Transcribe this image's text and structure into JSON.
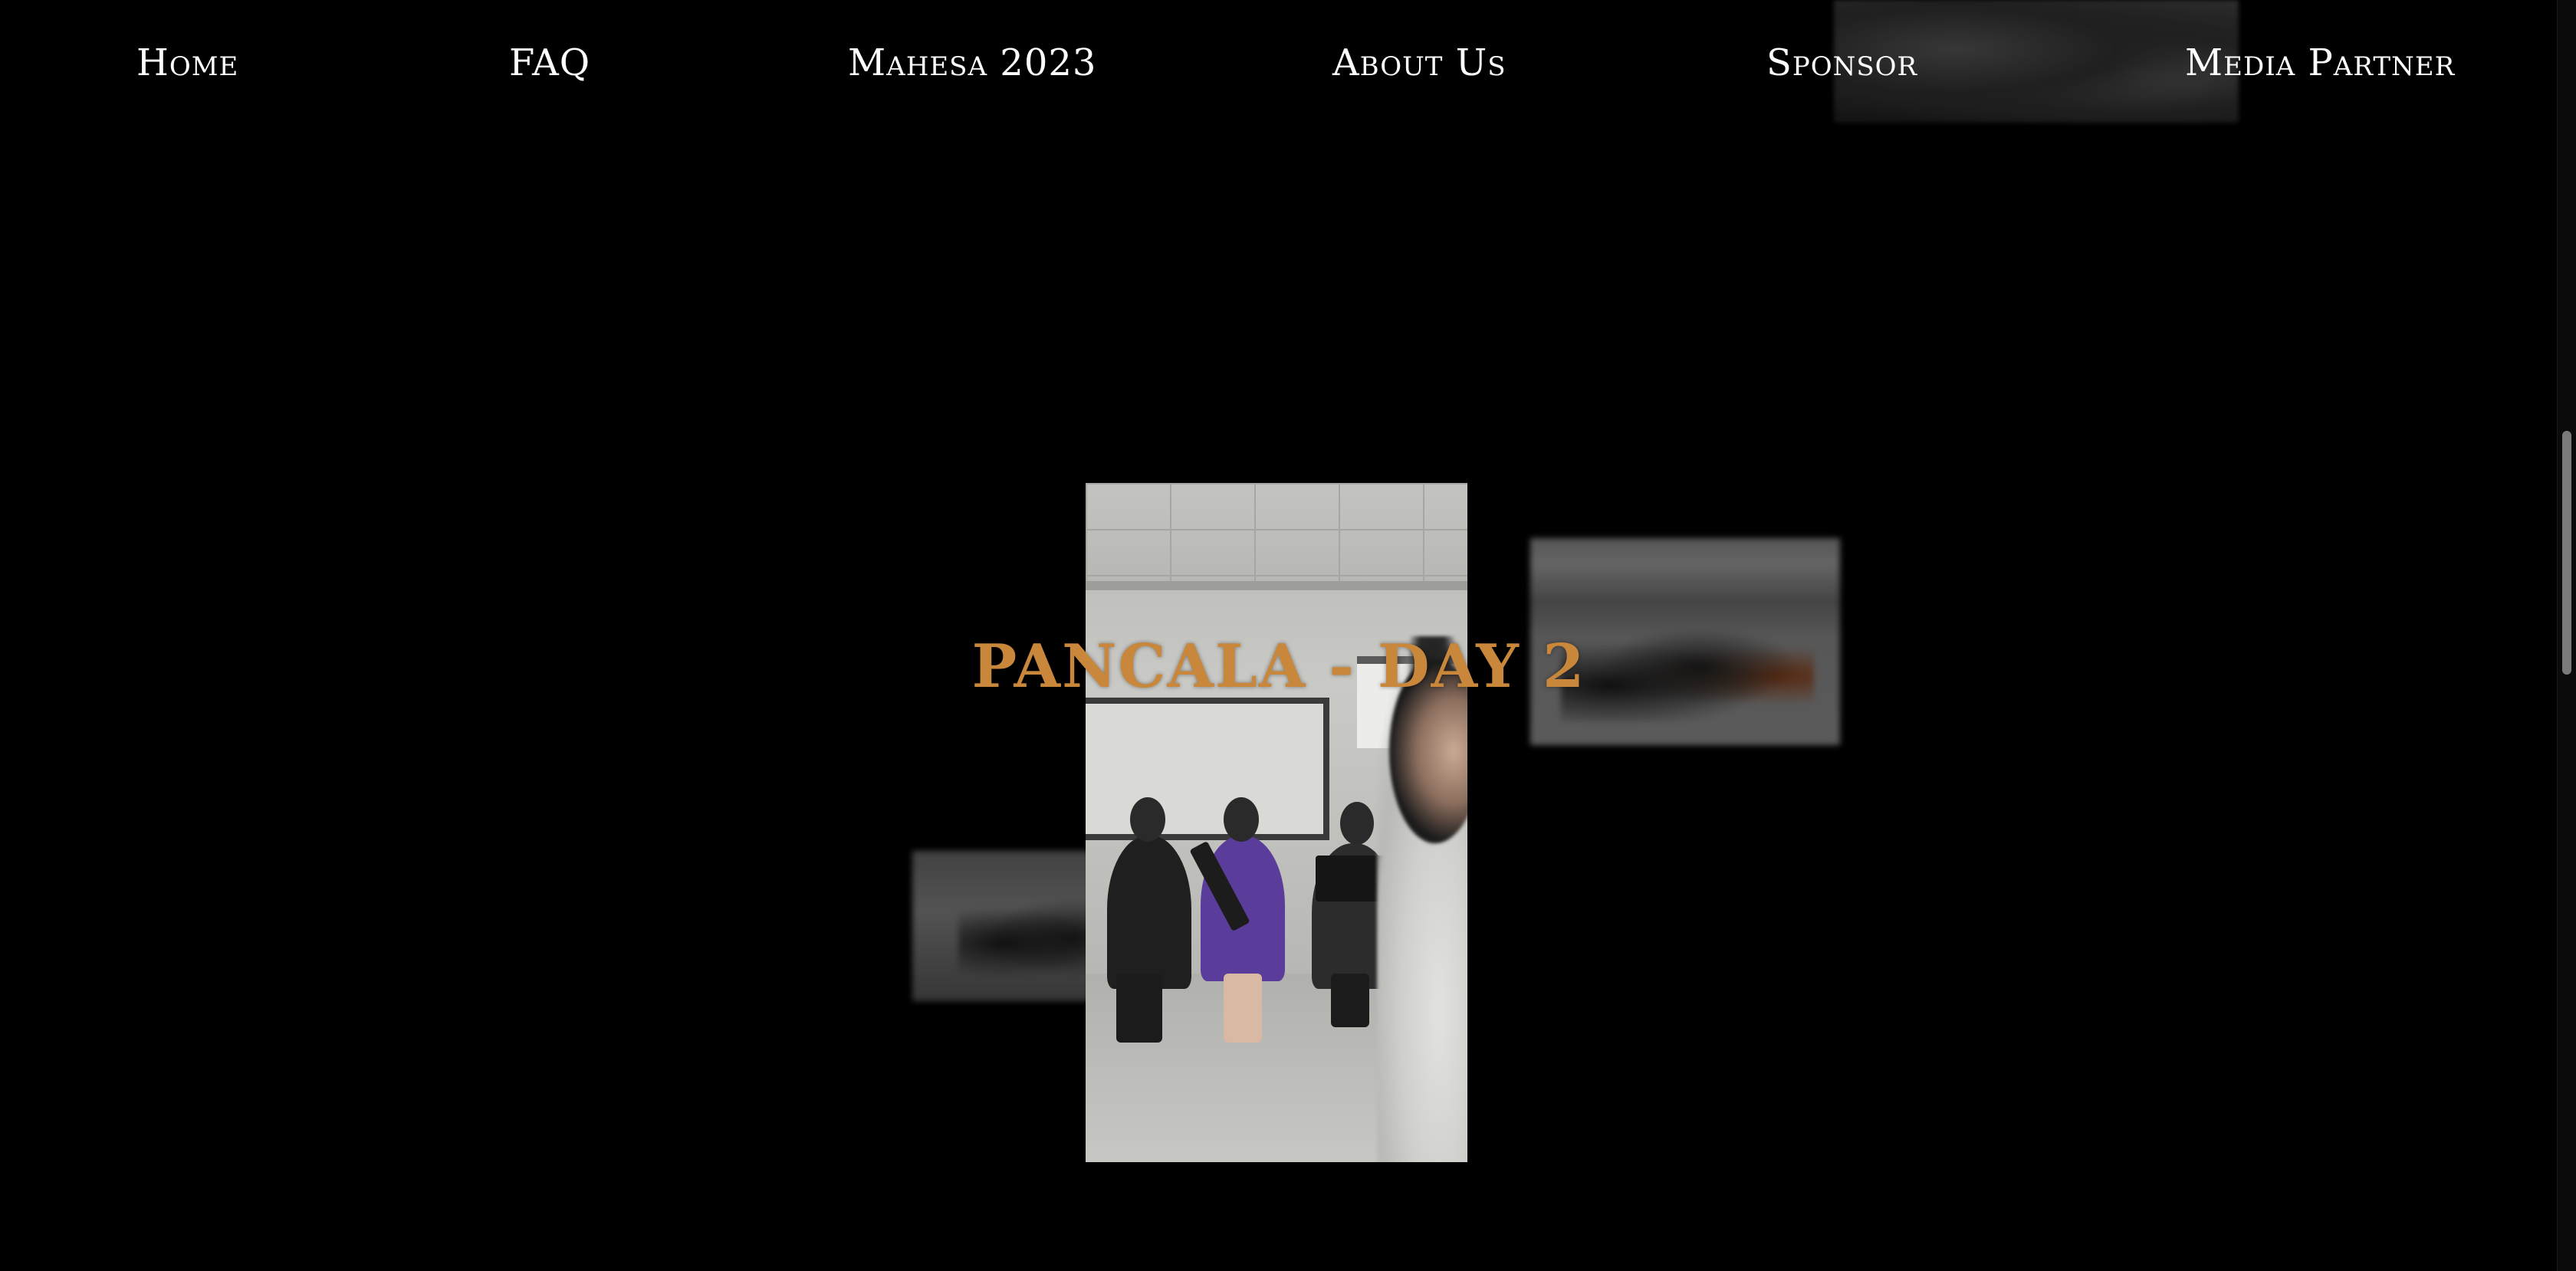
{
  "nav": {
    "items": [
      {
        "label": "Home"
      },
      {
        "label": "FAQ"
      },
      {
        "label": "Mahesa 2023"
      },
      {
        "label": "About Us"
      },
      {
        "label": "Sponsor"
      },
      {
        "label": "Media Partner"
      }
    ]
  },
  "gallery": {
    "title": "PANCALA - DAY 2",
    "title_color": "#c8873b",
    "background": "#000000"
  },
  "scrollbar": {
    "position_fraction": 0.34
  }
}
